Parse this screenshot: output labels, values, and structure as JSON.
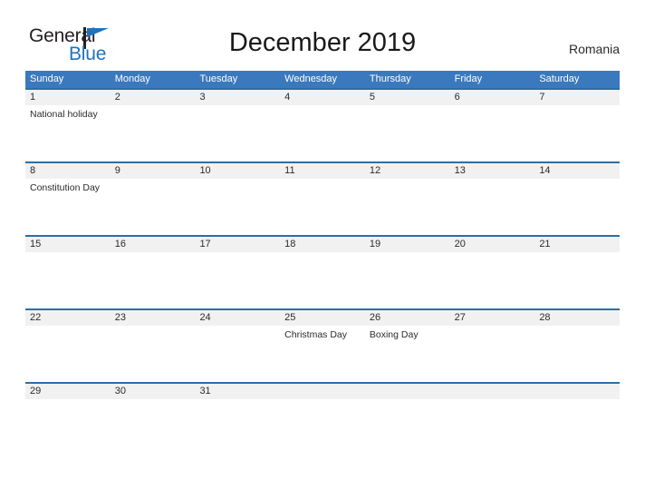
{
  "brand": {
    "name_part1": "General",
    "name_part2": "Blue",
    "flag_icon": "triangle-flag-icon",
    "color_dark": "#231f20",
    "color_blue": "#1d73bd"
  },
  "header": {
    "title": "December 2019",
    "country": "Romania"
  },
  "calendar": {
    "accent_header_color": "#3a79bd",
    "row_divider_color": "#2e6da4",
    "date_band_color": "#f1f1f1",
    "weekdays": [
      "Sunday",
      "Monday",
      "Tuesday",
      "Wednesday",
      "Thursday",
      "Friday",
      "Saturday"
    ],
    "weeks": [
      {
        "days": [
          {
            "date": "1",
            "event": "National holiday"
          },
          {
            "date": "2",
            "event": ""
          },
          {
            "date": "3",
            "event": ""
          },
          {
            "date": "4",
            "event": ""
          },
          {
            "date": "5",
            "event": ""
          },
          {
            "date": "6",
            "event": ""
          },
          {
            "date": "7",
            "event": ""
          }
        ]
      },
      {
        "days": [
          {
            "date": "8",
            "event": "Constitution Day"
          },
          {
            "date": "9",
            "event": ""
          },
          {
            "date": "10",
            "event": ""
          },
          {
            "date": "11",
            "event": ""
          },
          {
            "date": "12",
            "event": ""
          },
          {
            "date": "13",
            "event": ""
          },
          {
            "date": "14",
            "event": ""
          }
        ]
      },
      {
        "days": [
          {
            "date": "15",
            "event": ""
          },
          {
            "date": "16",
            "event": ""
          },
          {
            "date": "17",
            "event": ""
          },
          {
            "date": "18",
            "event": ""
          },
          {
            "date": "19",
            "event": ""
          },
          {
            "date": "20",
            "event": ""
          },
          {
            "date": "21",
            "event": ""
          }
        ]
      },
      {
        "days": [
          {
            "date": "22",
            "event": ""
          },
          {
            "date": "23",
            "event": ""
          },
          {
            "date": "24",
            "event": ""
          },
          {
            "date": "25",
            "event": "Christmas Day"
          },
          {
            "date": "26",
            "event": "Boxing Day"
          },
          {
            "date": "27",
            "event": ""
          },
          {
            "date": "28",
            "event": ""
          }
        ]
      },
      {
        "days": [
          {
            "date": "29",
            "event": ""
          },
          {
            "date": "30",
            "event": ""
          },
          {
            "date": "31",
            "event": ""
          },
          {
            "date": "",
            "event": ""
          },
          {
            "date": "",
            "event": ""
          },
          {
            "date": "",
            "event": ""
          },
          {
            "date": "",
            "event": ""
          }
        ]
      }
    ]
  }
}
